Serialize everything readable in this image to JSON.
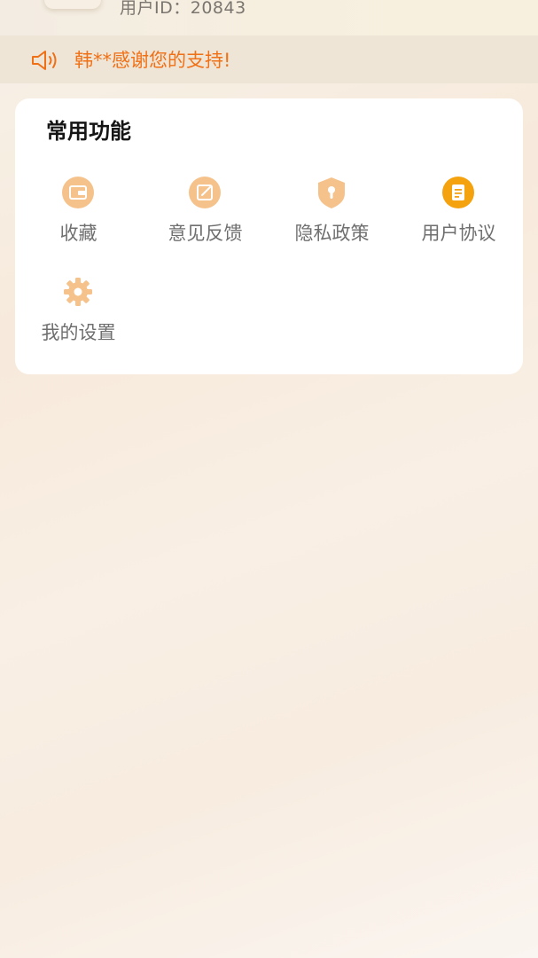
{
  "user": {
    "id_text": "用户ID：20843"
  },
  "notice": {
    "icon": "speaker-icon",
    "text": "韩**感谢您的支持!",
    "color": "#f07016"
  },
  "functions": {
    "title": "常用功能",
    "items": [
      {
        "label": "收藏",
        "icon": "wallet-icon",
        "color": "#f6c28b"
      },
      {
        "label": "意见反馈",
        "icon": "edit-icon",
        "color": "#f6c28b"
      },
      {
        "label": "隐私政策",
        "icon": "shield-keyhole-icon",
        "color": "#f6c28b"
      },
      {
        "label": "用户协议",
        "icon": "document-icon",
        "color": "#f4a20e"
      },
      {
        "label": "我的设置",
        "icon": "gear-icon",
        "color": "#f6c28b"
      }
    ]
  }
}
